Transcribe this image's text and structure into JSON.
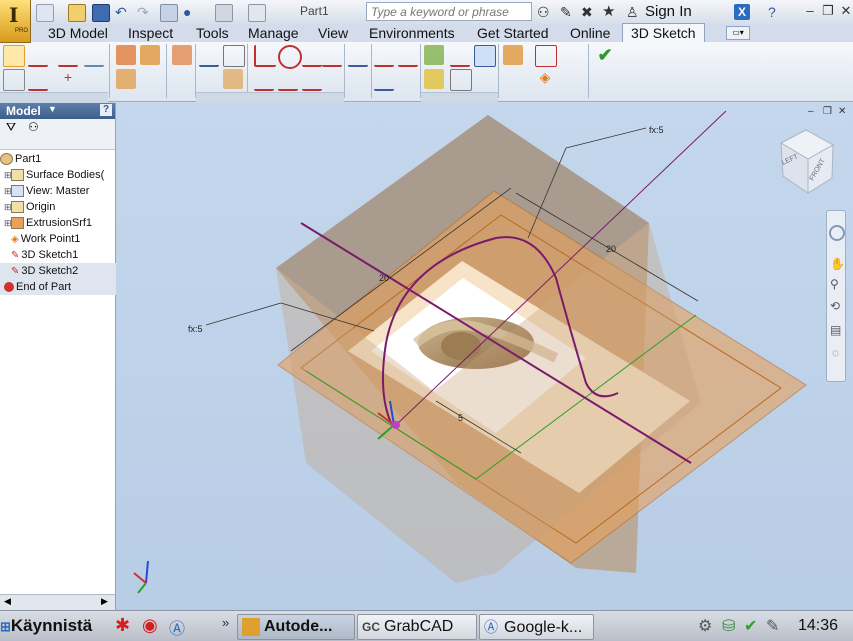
{
  "window": {
    "doc_title": "Part1",
    "search_placeholder": "Type a keyword or phrase",
    "sign_in": "Sign In",
    "app_letter": "I",
    "app_sub": "PRO"
  },
  "tabs": [
    {
      "label": "3D Model"
    },
    {
      "label": "Inspect"
    },
    {
      "label": "Tools"
    },
    {
      "label": "Manage"
    },
    {
      "label": "View"
    },
    {
      "label": "Environments"
    },
    {
      "label": "Get Started"
    },
    {
      "label": "Online"
    },
    {
      "label": "3D Sketch",
      "active": true
    }
  ],
  "browser": {
    "title": "Model",
    "help": "?",
    "items": [
      {
        "label": "Part1",
        "icon": "part-icon"
      },
      {
        "label": "Surface Bodies(",
        "icon": "folder-icon",
        "expand": "+"
      },
      {
        "label": "View: Master",
        "icon": "view-icon",
        "expand": "+"
      },
      {
        "label": "Origin",
        "icon": "folder-icon",
        "expand": "+"
      },
      {
        "label": "ExtrusionSrf1",
        "icon": "extrusion-icon",
        "expand": "+"
      },
      {
        "label": "Work Point1",
        "icon": "workpoint-icon"
      },
      {
        "label": "3D Sketch1",
        "icon": "sketch-icon"
      },
      {
        "label": "3D Sketch2",
        "icon": "sketch-icon",
        "selected": true
      },
      {
        "label": "End of Part",
        "icon": "end-icon"
      }
    ]
  },
  "viewport": {
    "annotations": {
      "fx_top": "fx:5",
      "fx_left": "fx:5",
      "dim_20_top": "20",
      "dim_20_left": "20",
      "dim_5": "5"
    },
    "viewcube_label": "LEFT",
    "viewcube_label2": "FRONT"
  },
  "taskbar": {
    "start": "Käynnistä",
    "tasks": [
      {
        "label": "Autode...",
        "icon": "inventor-icon",
        "active": true
      },
      {
        "label": "GrabCAD",
        "icon": "grabcad-icon"
      },
      {
        "label": "Google-k...",
        "icon": "google-icon"
      }
    ],
    "clock": "14:36"
  },
  "colors": {
    "accent": "#3c5f8c",
    "plane": "#e8a05a",
    "box": "#b89a7a",
    "sketch": "#7a1a6a"
  }
}
